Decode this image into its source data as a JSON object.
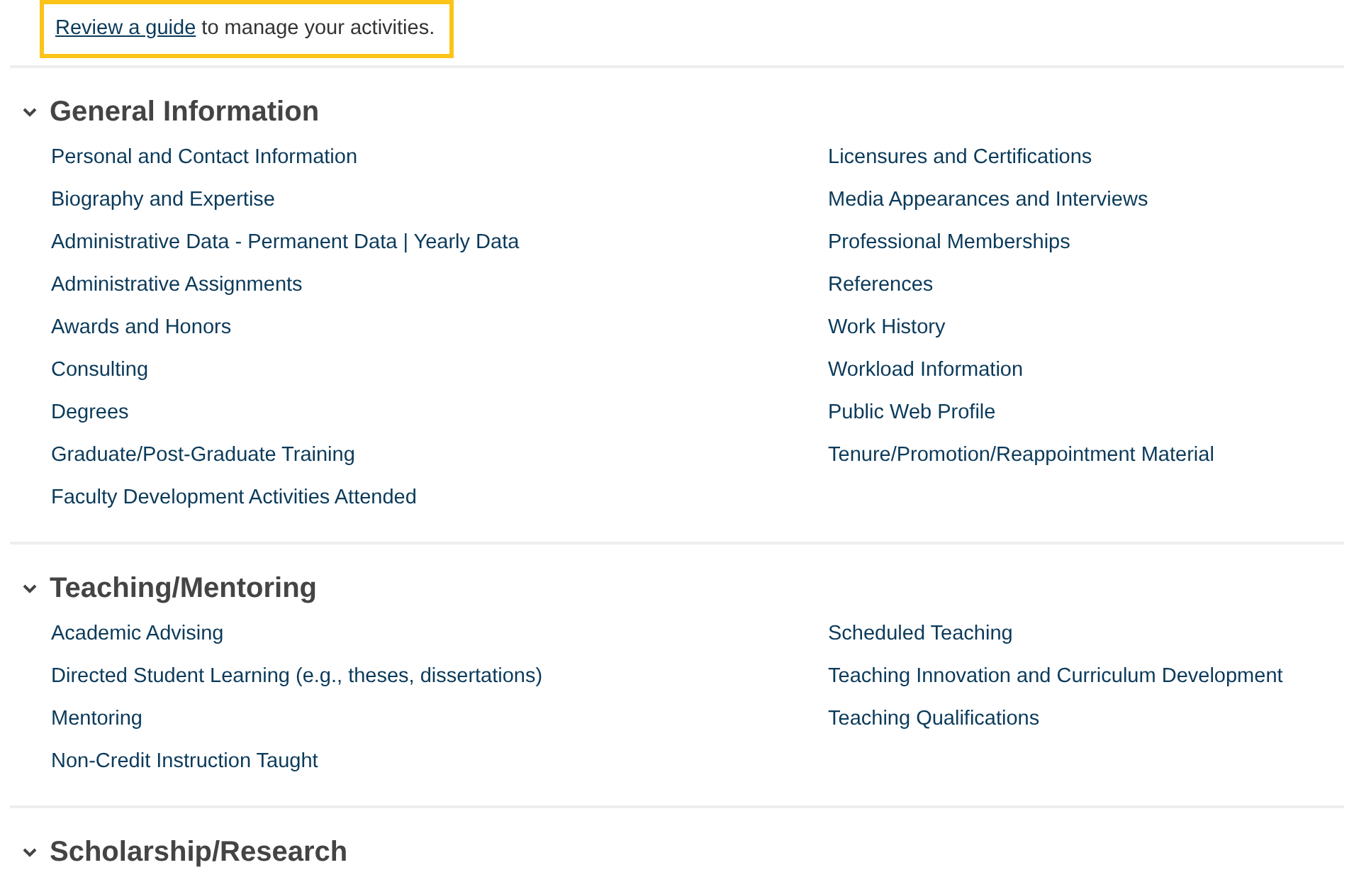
{
  "notice": {
    "link": "Review a guide",
    "text": " to manage your activities."
  },
  "sections": [
    {
      "title": "General Information",
      "expanded": true,
      "left": [
        "Personal and Contact Information",
        "Biography and Expertise",
        "Administrative Data - Permanent Data | Yearly Data",
        "Administrative Assignments",
        "Awards and Honors",
        "Consulting",
        "Degrees",
        "Graduate/Post-Graduate Training",
        "Faculty Development Activities Attended"
      ],
      "right": [
        "Licensures and Certifications",
        "Media Appearances and Interviews",
        "Professional Memberships",
        "References",
        "Work History",
        "Workload Information",
        "Public Web Profile",
        "Tenure/Promotion/Reappointment Material"
      ]
    },
    {
      "title": "Teaching/Mentoring",
      "expanded": true,
      "left": [
        "Academic Advising",
        "Directed Student Learning (e.g., theses, dissertations)",
        "Mentoring",
        "Non-Credit Instruction Taught"
      ],
      "right": [
        "Scheduled Teaching",
        "Teaching Innovation and Curriculum Development",
        "Teaching Qualifications"
      ]
    },
    {
      "title": "Scholarship/Research",
      "expanded": true
    }
  ]
}
